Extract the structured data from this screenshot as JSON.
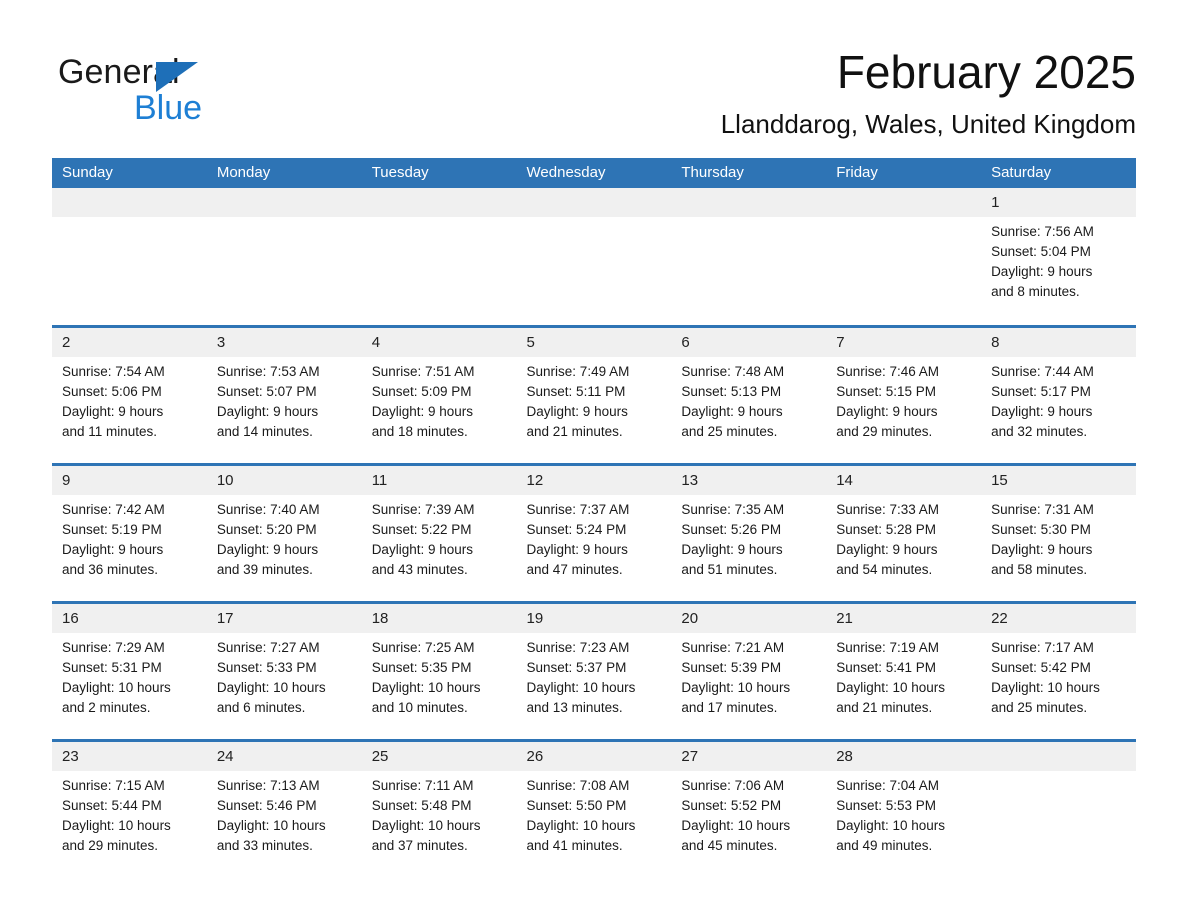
{
  "brand": {
    "name_part1": "General",
    "name_part2": "Blue",
    "triangle_color": "#1e6fb8",
    "blue_text_color": "#1e7fd4"
  },
  "header": {
    "title": "February 2025",
    "subtitle": "Llanddarog, Wales, United Kingdom",
    "accent_color": "#2e74b5",
    "daynum_band_color": "#f0f0f0"
  },
  "weekday_headers": [
    "Sunday",
    "Monday",
    "Tuesday",
    "Wednesday",
    "Thursday",
    "Friday",
    "Saturday"
  ],
  "weeks": [
    [
      {
        "day": "",
        "lines": []
      },
      {
        "day": "",
        "lines": []
      },
      {
        "day": "",
        "lines": []
      },
      {
        "day": "",
        "lines": []
      },
      {
        "day": "",
        "lines": []
      },
      {
        "day": "",
        "lines": []
      },
      {
        "day": "1",
        "lines": [
          "Sunrise: 7:56 AM",
          "Sunset: 5:04 PM",
          "Daylight: 9 hours",
          "and 8 minutes."
        ]
      }
    ],
    [
      {
        "day": "2",
        "lines": [
          "Sunrise: 7:54 AM",
          "Sunset: 5:06 PM",
          "Daylight: 9 hours",
          "and 11 minutes."
        ]
      },
      {
        "day": "3",
        "lines": [
          "Sunrise: 7:53 AM",
          "Sunset: 5:07 PM",
          "Daylight: 9 hours",
          "and 14 minutes."
        ]
      },
      {
        "day": "4",
        "lines": [
          "Sunrise: 7:51 AM",
          "Sunset: 5:09 PM",
          "Daylight: 9 hours",
          "and 18 minutes."
        ]
      },
      {
        "day": "5",
        "lines": [
          "Sunrise: 7:49 AM",
          "Sunset: 5:11 PM",
          "Daylight: 9 hours",
          "and 21 minutes."
        ]
      },
      {
        "day": "6",
        "lines": [
          "Sunrise: 7:48 AM",
          "Sunset: 5:13 PM",
          "Daylight: 9 hours",
          "and 25 minutes."
        ]
      },
      {
        "day": "7",
        "lines": [
          "Sunrise: 7:46 AM",
          "Sunset: 5:15 PM",
          "Daylight: 9 hours",
          "and 29 minutes."
        ]
      },
      {
        "day": "8",
        "lines": [
          "Sunrise: 7:44 AM",
          "Sunset: 5:17 PM",
          "Daylight: 9 hours",
          "and 32 minutes."
        ]
      }
    ],
    [
      {
        "day": "9",
        "lines": [
          "Sunrise: 7:42 AM",
          "Sunset: 5:19 PM",
          "Daylight: 9 hours",
          "and 36 minutes."
        ]
      },
      {
        "day": "10",
        "lines": [
          "Sunrise: 7:40 AM",
          "Sunset: 5:20 PM",
          "Daylight: 9 hours",
          "and 39 minutes."
        ]
      },
      {
        "day": "11",
        "lines": [
          "Sunrise: 7:39 AM",
          "Sunset: 5:22 PM",
          "Daylight: 9 hours",
          "and 43 minutes."
        ]
      },
      {
        "day": "12",
        "lines": [
          "Sunrise: 7:37 AM",
          "Sunset: 5:24 PM",
          "Daylight: 9 hours",
          "and 47 minutes."
        ]
      },
      {
        "day": "13",
        "lines": [
          "Sunrise: 7:35 AM",
          "Sunset: 5:26 PM",
          "Daylight: 9 hours",
          "and 51 minutes."
        ]
      },
      {
        "day": "14",
        "lines": [
          "Sunrise: 7:33 AM",
          "Sunset: 5:28 PM",
          "Daylight: 9 hours",
          "and 54 minutes."
        ]
      },
      {
        "day": "15",
        "lines": [
          "Sunrise: 7:31 AM",
          "Sunset: 5:30 PM",
          "Daylight: 9 hours",
          "and 58 minutes."
        ]
      }
    ],
    [
      {
        "day": "16",
        "lines": [
          "Sunrise: 7:29 AM",
          "Sunset: 5:31 PM",
          "Daylight: 10 hours",
          "and 2 minutes."
        ]
      },
      {
        "day": "17",
        "lines": [
          "Sunrise: 7:27 AM",
          "Sunset: 5:33 PM",
          "Daylight: 10 hours",
          "and 6 minutes."
        ]
      },
      {
        "day": "18",
        "lines": [
          "Sunrise: 7:25 AM",
          "Sunset: 5:35 PM",
          "Daylight: 10 hours",
          "and 10 minutes."
        ]
      },
      {
        "day": "19",
        "lines": [
          "Sunrise: 7:23 AM",
          "Sunset: 5:37 PM",
          "Daylight: 10 hours",
          "and 13 minutes."
        ]
      },
      {
        "day": "20",
        "lines": [
          "Sunrise: 7:21 AM",
          "Sunset: 5:39 PM",
          "Daylight: 10 hours",
          "and 17 minutes."
        ]
      },
      {
        "day": "21",
        "lines": [
          "Sunrise: 7:19 AM",
          "Sunset: 5:41 PM",
          "Daylight: 10 hours",
          "and 21 minutes."
        ]
      },
      {
        "day": "22",
        "lines": [
          "Sunrise: 7:17 AM",
          "Sunset: 5:42 PM",
          "Daylight: 10 hours",
          "and 25 minutes."
        ]
      }
    ],
    [
      {
        "day": "23",
        "lines": [
          "Sunrise: 7:15 AM",
          "Sunset: 5:44 PM",
          "Daylight: 10 hours",
          "and 29 minutes."
        ]
      },
      {
        "day": "24",
        "lines": [
          "Sunrise: 7:13 AM",
          "Sunset: 5:46 PM",
          "Daylight: 10 hours",
          "and 33 minutes."
        ]
      },
      {
        "day": "25",
        "lines": [
          "Sunrise: 7:11 AM",
          "Sunset: 5:48 PM",
          "Daylight: 10 hours",
          "and 37 minutes."
        ]
      },
      {
        "day": "26",
        "lines": [
          "Sunrise: 7:08 AM",
          "Sunset: 5:50 PM",
          "Daylight: 10 hours",
          "and 41 minutes."
        ]
      },
      {
        "day": "27",
        "lines": [
          "Sunrise: 7:06 AM",
          "Sunset: 5:52 PM",
          "Daylight: 10 hours",
          "and 45 minutes."
        ]
      },
      {
        "day": "28",
        "lines": [
          "Sunrise: 7:04 AM",
          "Sunset: 5:53 PM",
          "Daylight: 10 hours",
          "and 49 minutes."
        ]
      },
      {
        "day": "",
        "lines": []
      }
    ]
  ]
}
